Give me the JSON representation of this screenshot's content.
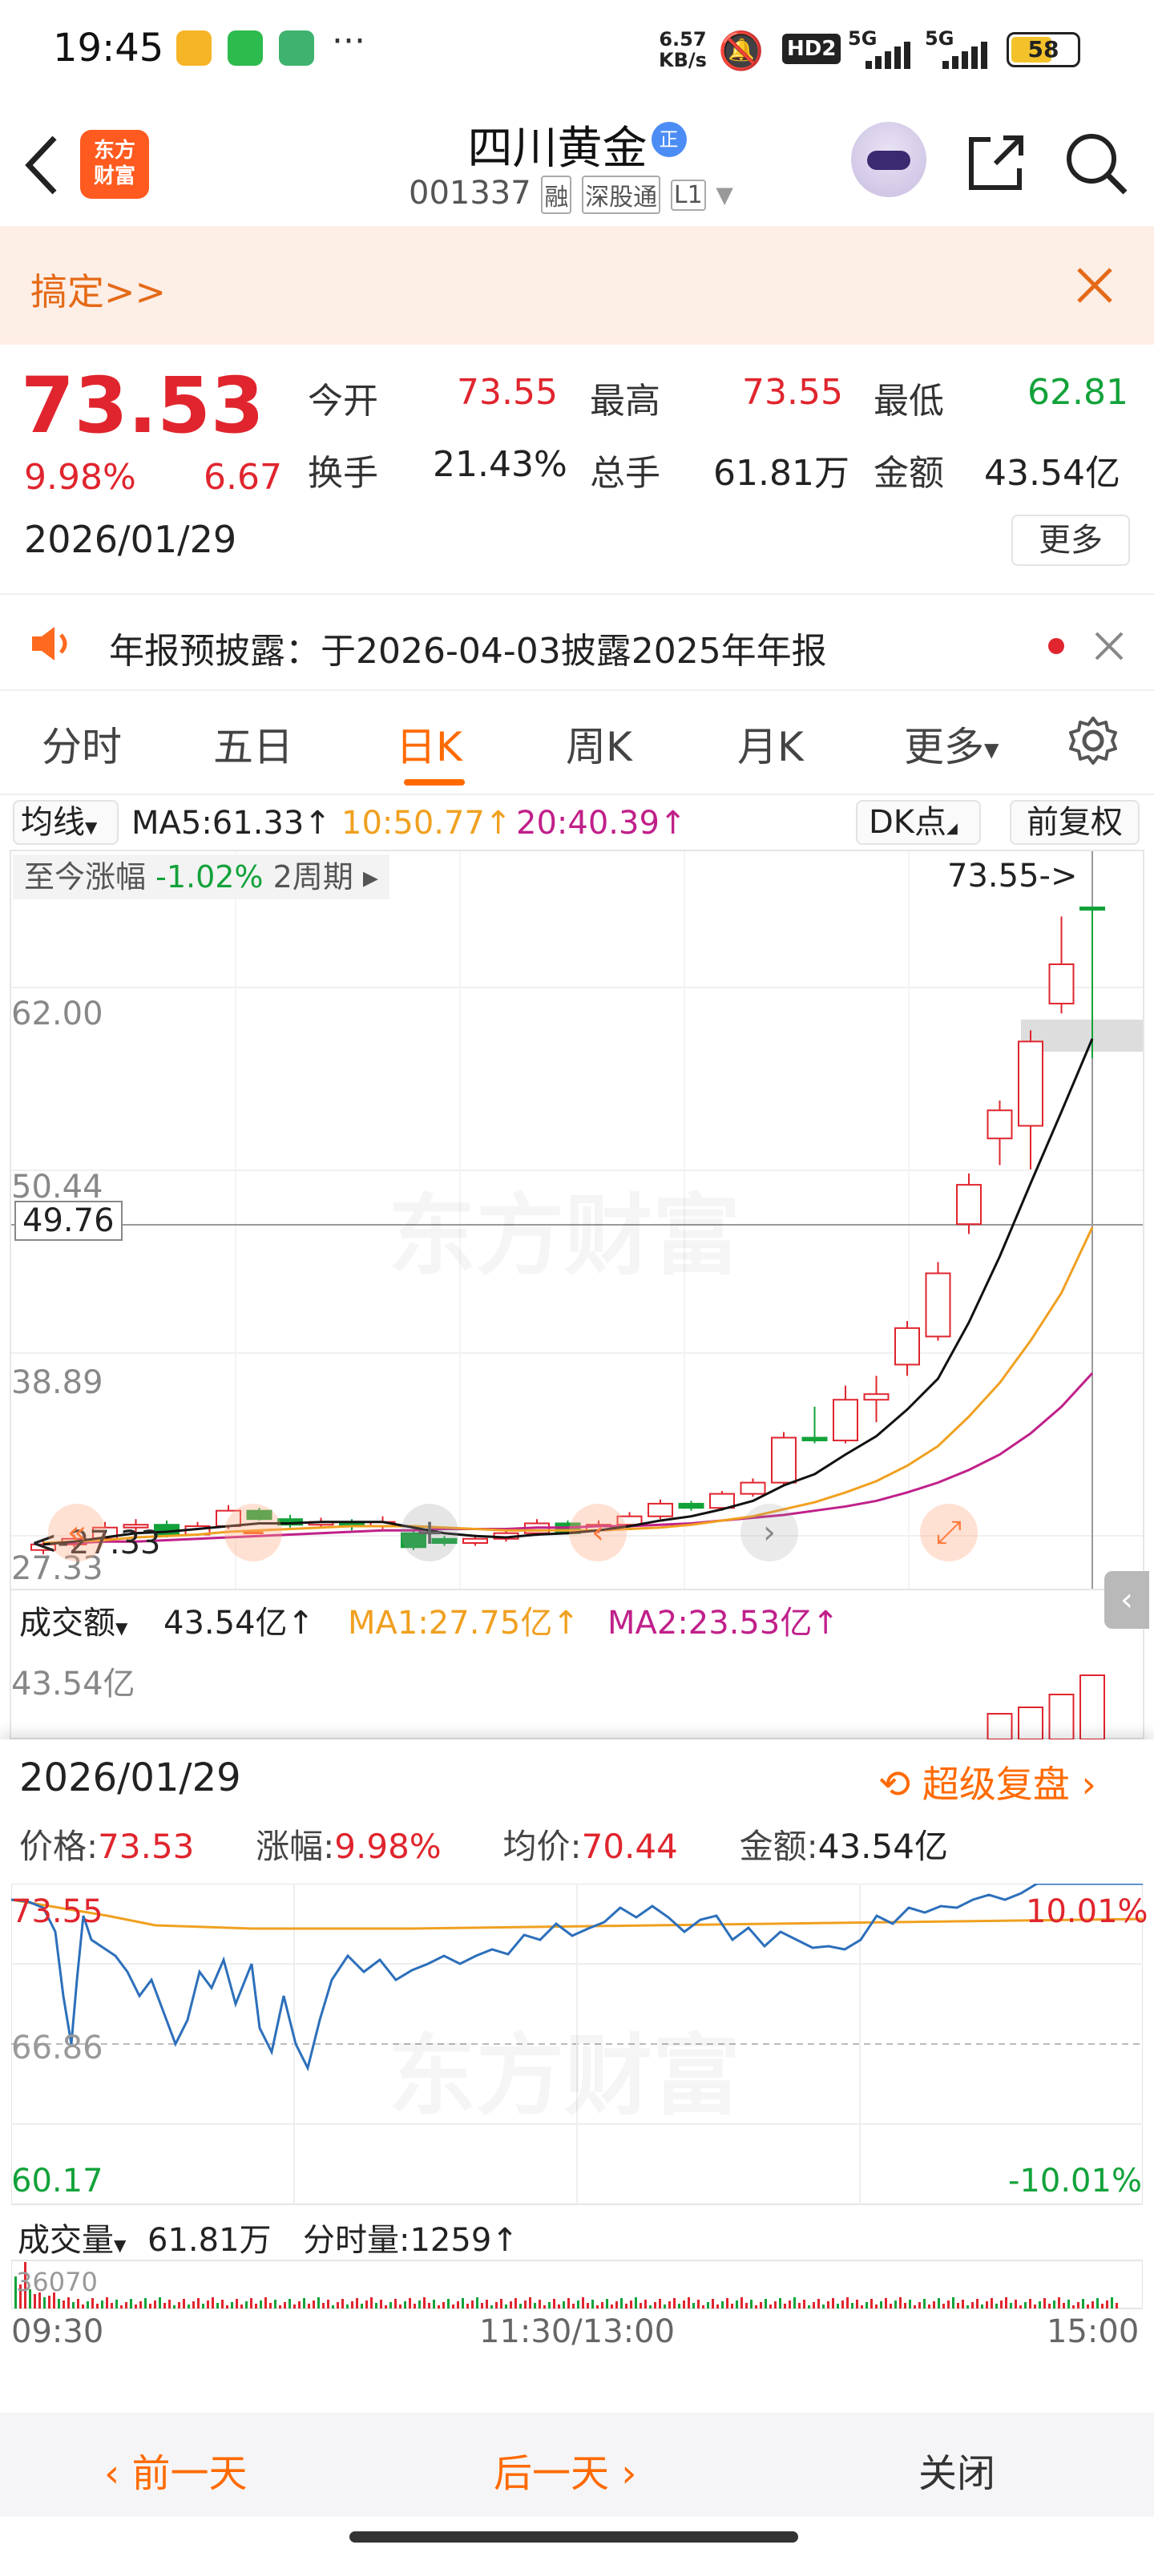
{
  "status_bar": {
    "time": "19:45",
    "net_speed": "6.57",
    "net_unit": "KB/s",
    "battery": "58",
    "signal_1": "5G",
    "signal_2": "5G",
    "hd": "HD2"
  },
  "header": {
    "app_logo": "东方\n财富",
    "stock_name": "四川黄金",
    "name_badge": "正",
    "stock_code": "001337",
    "tags": [
      "融",
      "深股通",
      "L1"
    ]
  },
  "banner": {
    "text": "搞定>>"
  },
  "quote": {
    "price": "73.53",
    "change_pct": "9.98%",
    "change": "6.67",
    "date": "2026/01/29",
    "more_label": "更多",
    "stats": [
      {
        "label": "今开",
        "value": "73.55"
      },
      {
        "label": "最高",
        "value": "73.55"
      },
      {
        "label": "最低",
        "value": "62.81"
      },
      {
        "label": "换手",
        "value": "21.43%"
      },
      {
        "label": "总手",
        "value": "61.81万"
      },
      {
        "label": "金额",
        "value": "43.54亿"
      }
    ]
  },
  "notice": {
    "text": "年报预披露：于2026-04-03披露2025年年报"
  },
  "tabs": [
    "分时",
    "五日",
    "日K",
    "周K",
    "月K",
    "更多"
  ],
  "active_tab": "日K",
  "kline": {
    "ma_selector": "均线",
    "ma5": "MA5:61.33",
    "ma10": "10:50.77",
    "ma20": "20:40.39",
    "dk_label": "DK点",
    "adjust_label": "前复权",
    "since_label": "至今涨幅",
    "since_value": "-1.02%",
    "since_period": "2周期",
    "max_marker": "73.55->",
    "min_marker": "<-27.33",
    "y_labels": [
      "62.00",
      "50.44",
      "38.89",
      "27.33"
    ],
    "crosshair_value": "49.76",
    "watermark": "东方财富",
    "volume_label": "成交额",
    "volume_value": "43.54亿",
    "vol_ma1": "MA1:27.75亿",
    "vol_ma2": "MA2:23.53亿",
    "vol_axis": "43.54亿",
    "colors": {
      "up": "#e0252e",
      "down": "#12a23a",
      "ma5": "#111111",
      "ma10": "#f0a020",
      "ma20": "#c0208a"
    }
  },
  "chart_data": {
    "type": "candlestick",
    "ylim": [
      27.33,
      73.55
    ],
    "candles": [
      {
        "o": 27.8,
        "c": 28.2,
        "h": 28.5,
        "l": 27.5
      },
      {
        "o": 28.2,
        "c": 28.6,
        "h": 28.9,
        "l": 28.0
      },
      {
        "o": 28.6,
        "c": 29.4,
        "h": 29.8,
        "l": 28.4
      },
      {
        "o": 29.4,
        "c": 29.6,
        "h": 30.0,
        "l": 29.0
      },
      {
        "o": 29.6,
        "c": 28.9,
        "h": 29.9,
        "l": 28.7
      },
      {
        "o": 28.9,
        "c": 29.5,
        "h": 29.8,
        "l": 28.8
      },
      {
        "o": 29.5,
        "c": 30.6,
        "h": 31.0,
        "l": 29.3
      },
      {
        "o": 30.6,
        "c": 30.0,
        "h": 30.8,
        "l": 29.9
      },
      {
        "o": 30.0,
        "c": 29.6,
        "h": 30.3,
        "l": 29.4
      },
      {
        "o": 29.6,
        "c": 29.8,
        "h": 30.1,
        "l": 29.4
      },
      {
        "o": 29.8,
        "c": 29.5,
        "h": 30.0,
        "l": 29.2
      },
      {
        "o": 29.5,
        "c": 29.8,
        "h": 30.2,
        "l": 29.3
      },
      {
        "o": 29.0,
        "c": 28.0,
        "h": 29.3,
        "l": 27.8
      },
      {
        "o": 28.6,
        "c": 28.3,
        "h": 28.8,
        "l": 28.1
      },
      {
        "o": 28.3,
        "c": 28.6,
        "h": 28.9,
        "l": 28.1
      },
      {
        "o": 28.6,
        "c": 29.0,
        "h": 29.3,
        "l": 28.4
      },
      {
        "o": 29.0,
        "c": 29.7,
        "h": 30.0,
        "l": 28.8
      },
      {
        "o": 29.7,
        "c": 29.0,
        "h": 29.9,
        "l": 28.9
      },
      {
        "o": 29.2,
        "c": 29.6,
        "h": 29.9,
        "l": 29.0
      },
      {
        "o": 29.6,
        "c": 30.2,
        "h": 30.5,
        "l": 29.4
      },
      {
        "o": 30.2,
        "c": 31.1,
        "h": 31.4,
        "l": 30.0
      },
      {
        "o": 31.1,
        "c": 30.8,
        "h": 31.3,
        "l": 30.6
      },
      {
        "o": 30.8,
        "c": 31.8,
        "h": 32.0,
        "l": 30.6
      },
      {
        "o": 31.8,
        "c": 32.6,
        "h": 32.9,
        "l": 31.6
      },
      {
        "o": 32.6,
        "c": 35.8,
        "h": 36.2,
        "l": 32.4
      },
      {
        "o": 35.8,
        "c": 35.6,
        "h": 38.0,
        "l": 35.4
      },
      {
        "o": 35.6,
        "c": 38.5,
        "h": 39.5,
        "l": 35.4
      },
      {
        "o": 38.5,
        "c": 38.9,
        "h": 40.2,
        "l": 36.9
      },
      {
        "o": 41.0,
        "c": 43.6,
        "h": 44.1,
        "l": 40.2
      },
      {
        "o": 43.0,
        "c": 47.5,
        "h": 48.3,
        "l": 42.7
      },
      {
        "o": 51.0,
        "c": 53.8,
        "h": 54.6,
        "l": 50.3
      },
      {
        "o": 57.1,
        "c": 59.1,
        "h": 59.8,
        "l": 55.2
      },
      {
        "o": 58.0,
        "c": 64.0,
        "h": 64.8,
        "l": 54.9
      },
      {
        "o": 66.7,
        "c": 69.5,
        "h": 72.9,
        "l": 66.0
      },
      {
        "o": 73.55,
        "c": 73.53,
        "h": 73.55,
        "l": 62.81
      }
    ],
    "ma5": [
      28.2,
      28.4,
      28.7,
      29.0,
      29.1,
      29.3,
      29.5,
      29.7,
      29.7,
      29.8,
      29.8,
      29.8,
      29.4,
      29.0,
      28.8,
      28.7,
      28.9,
      29.0,
      29.2,
      29.5,
      29.9,
      30.2,
      30.7,
      31.3,
      32.4,
      33.2,
      34.6,
      35.9,
      37.8,
      40.0,
      44.0,
      48.7,
      53.9,
      59.0,
      64.2
    ],
    "ma10": [
      28.3,
      28.4,
      28.5,
      28.7,
      28.8,
      28.9,
      29.1,
      29.2,
      29.3,
      29.4,
      29.5,
      29.5,
      29.5,
      29.4,
      29.3,
      29.2,
      29.2,
      29.2,
      29.2,
      29.3,
      29.4,
      29.6,
      29.9,
      30.2,
      30.7,
      31.2,
      31.9,
      32.7,
      33.8,
      35.2,
      37.3,
      39.7,
      42.7,
      46.1,
      50.77
    ],
    "ma20": [
      28.3,
      28.3,
      28.4,
      28.4,
      28.5,
      28.6,
      28.7,
      28.8,
      28.9,
      29.0,
      29.1,
      29.2,
      29.2,
      29.3,
      29.3,
      29.3,
      29.4,
      29.4,
      29.5,
      29.5,
      29.6,
      29.7,
      29.9,
      30.1,
      30.3,
      30.6,
      30.9,
      31.3,
      31.9,
      32.6,
      33.5,
      34.6,
      36.1,
      38.0,
      40.39
    ],
    "volume_last": [
      0.4,
      0.5,
      0.7,
      1.0
    ]
  },
  "popup": {
    "date": "2026/01/29",
    "replay_label": "超级复盘",
    "price_label": "价格:",
    "price_value": "73.53",
    "pct_label": "涨幅:",
    "pct_value": "9.98%",
    "avg_label": "均价:",
    "avg_value": "70.44",
    "amount_label": "金额:",
    "amount_value": "43.54亿",
    "y_top": "73.55",
    "y_mid": "66.86",
    "y_bottom": "60.17",
    "pct_top": "10.01%",
    "pct_bottom": "-10.01%",
    "vol_label": "成交量",
    "vol_value": "61.81万",
    "tick_vol": "分时量:1259",
    "vol_axis": "36070",
    "time_start": "09:30",
    "time_mid": "11:30/13:00",
    "time_end": "15:00",
    "watermark": "东方财富"
  },
  "bottom": {
    "prev": "前一天",
    "next": "后一天",
    "close": "关闭"
  }
}
